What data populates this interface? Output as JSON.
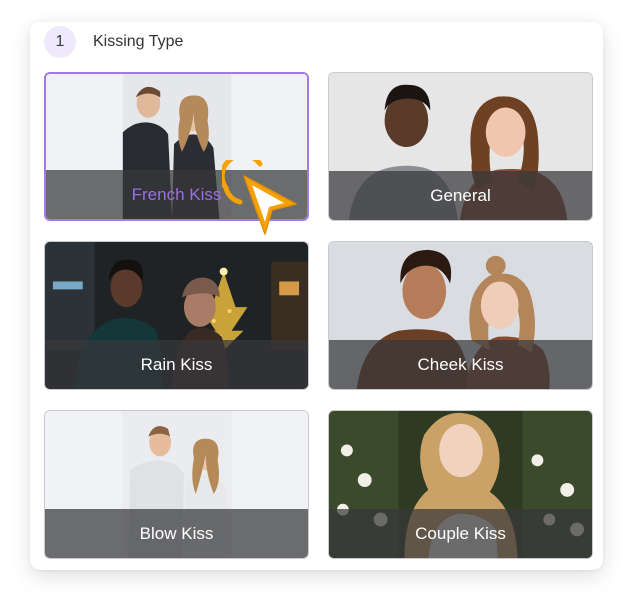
{
  "section": {
    "step_number": "1",
    "title": "Kissing Type"
  },
  "cards": [
    {
      "label": "French Kiss",
      "selected": true
    },
    {
      "label": "General",
      "selected": false
    },
    {
      "label": "Rain Kiss",
      "selected": false
    },
    {
      "label": "Cheek Kiss",
      "selected": false
    },
    {
      "label": "Blow Kiss",
      "selected": false
    },
    {
      "label": "Couple Kiss",
      "selected": false
    }
  ],
  "colors": {
    "accent": "#a07ae6",
    "cursor": "#f5a20a",
    "badge_bg": "#efeafb"
  }
}
